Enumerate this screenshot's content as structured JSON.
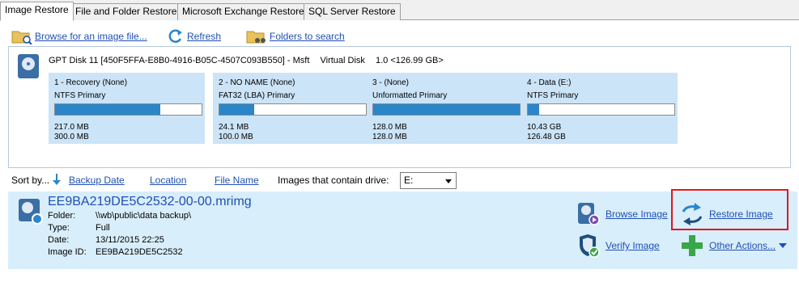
{
  "tabs": [
    {
      "label": "Image Restore",
      "active": true
    },
    {
      "label": "File and Folder Restore",
      "active": false
    },
    {
      "label": "Microsoft Exchange Restore",
      "active": false
    },
    {
      "label": "SQL Server Restore",
      "active": false
    }
  ],
  "toolbar": {
    "browse_label": "Browse for an image file...",
    "refresh_label": "Refresh",
    "folders_label": "Folders to search"
  },
  "disk": {
    "name": "GPT Disk 11 [450F5FFA-E8B0-4916-B05C-4507C093B550] - Msft",
    "kind": "Virtual Disk",
    "size": "1.0  <126.99 GB>",
    "partitions": [
      {
        "name": "1 - Recovery (None)",
        "type": "NTFS Primary",
        "used": "217.0 MB",
        "total": "300.0 MB",
        "fill_fraction": 0.72
      },
      {
        "name": "2 - NO NAME (None)",
        "type": "FAT32 (LBA) Primary",
        "used": "24.1 MB",
        "total": "100.0 MB",
        "fill_fraction": 0.24
      },
      {
        "name": "3 -  (None)",
        "type": "Unformatted Primary",
        "used": "128.0 MB",
        "total": "128.0 MB",
        "fill_fraction": 1.0
      },
      {
        "name": "4 - Data (E:)",
        "type": "NTFS Primary",
        "used": "10.43 GB",
        "total": "126.48 GB",
        "fill_fraction": 0.08
      }
    ]
  },
  "sort": {
    "label": "Sort by...",
    "backup_date": "Backup Date",
    "location": "Location",
    "file_name": "File Name",
    "drive_label": "Images that contain drive:",
    "drive_value": "E:"
  },
  "image": {
    "title": "EE9BA219DE5C2532-00-00.mrimg",
    "folder_key": "Folder:",
    "folder": "\\\\wb\\public\\data backup\\",
    "type_key": "Type:",
    "type": "Full",
    "date_key": "Date:",
    "date": "13/11/2015 22:25",
    "id_key": "Image ID:",
    "id": "EE9BA219DE5C2532"
  },
  "actions": {
    "browse_image": "Browse Image",
    "restore_image": "Restore Image",
    "verify_image": "Verify Image",
    "other_actions": "Other Actions..."
  },
  "colors": {
    "accent": "#2b85c9",
    "link": "#1f4fb4",
    "partition_bg": "#cce4f7",
    "image_panel_bg": "#d9eefb",
    "highlight": "#e0161b"
  }
}
